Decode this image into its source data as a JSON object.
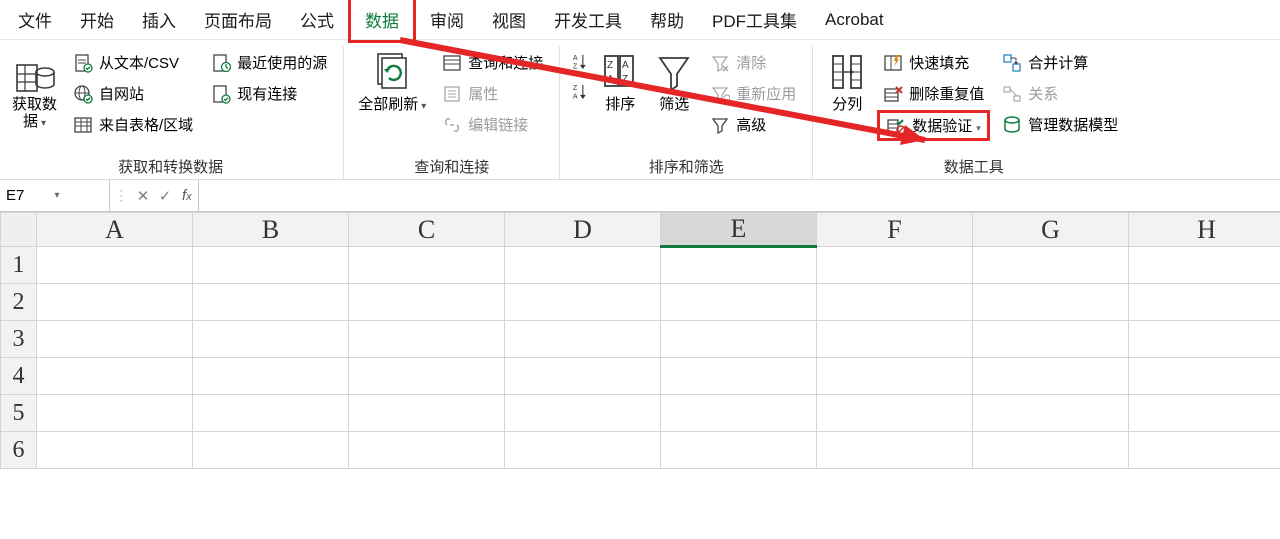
{
  "tabs": {
    "file": "文件",
    "home": "开始",
    "insert": "插入",
    "layout": "页面布局",
    "formula": "公式",
    "data": "数据",
    "review": "审阅",
    "view": "视图",
    "dev": "开发工具",
    "help": "帮助",
    "pdf": "PDF工具集",
    "acrobat": "Acrobat"
  },
  "ribbon": {
    "getdata": {
      "big": "获取数\n据",
      "title": "获取和转换数据",
      "csv": "从文本/CSV",
      "web": "自网站",
      "range": "来自表格/区域",
      "recent": "最近使用的源",
      "conn": "现有连接"
    },
    "refresh": {
      "big": "全部刷新",
      "title": "查询和连接",
      "qc": "查询和连接",
      "prop": "属性",
      "link": "编辑链接"
    },
    "sort": {
      "big_sort": "排序",
      "big_filter": "筛选",
      "title": "排序和筛选",
      "clear": "清除",
      "reapply": "重新应用",
      "adv": "高级"
    },
    "tools": {
      "split": "分列",
      "title": "数据工具",
      "flash": "快速填充",
      "dedup": "删除重复值",
      "valid": "数据验证",
      "consol": "合并计算",
      "rel": "关系",
      "model": "管理数据模型"
    }
  },
  "formula_bar": {
    "cell": "E7"
  },
  "grid": {
    "cols": [
      "A",
      "B",
      "C",
      "D",
      "E",
      "F",
      "G",
      "H"
    ],
    "rows": [
      "1",
      "2",
      "3",
      "4",
      "5",
      "6"
    ],
    "selected_col": "E"
  }
}
